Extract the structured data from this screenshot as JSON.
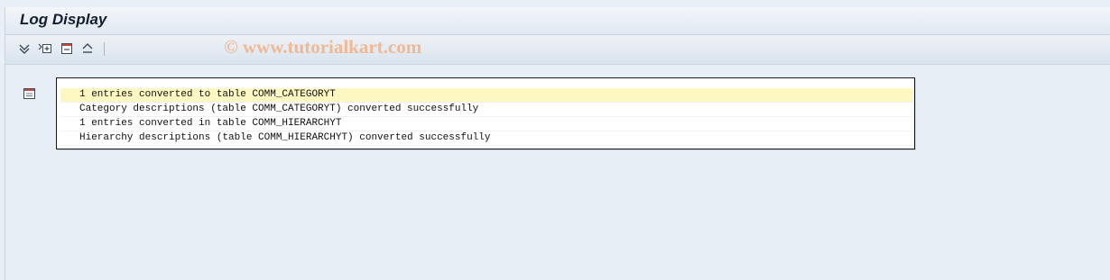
{
  "window": {
    "title": "Log Display"
  },
  "toolbar": {
    "buttons": [
      {
        "icon": "expand-all-icon",
        "label": "Expand all"
      },
      {
        "icon": "expand-subtree-icon",
        "label": "Expand subtree"
      },
      {
        "icon": "collapse-subtree-icon",
        "label": "Collapse subtree"
      },
      {
        "icon": "collapse-all-icon",
        "label": "Collapse all"
      }
    ]
  },
  "watermark": {
    "text": "© www.tutorialkart.com"
  },
  "log": {
    "node_icon": "log-node-icon",
    "rows": [
      {
        "text": "1 entries converted to table COMM_CATEGORYT",
        "selected": true
      },
      {
        "text": "Category descriptions (table COMM_CATEGORYT) converted successfully",
        "selected": false
      },
      {
        "text": "1 entries converted in table COMM_HIERARCHYT",
        "selected": false
      },
      {
        "text": "Hierarchy descriptions (table COMM_HIERARCHYT) converted successfully",
        "selected": false
      }
    ]
  },
  "colors": {
    "background": "#e8eef5",
    "selected_row": "#fdf8c2",
    "watermark": "#f2b48a"
  }
}
